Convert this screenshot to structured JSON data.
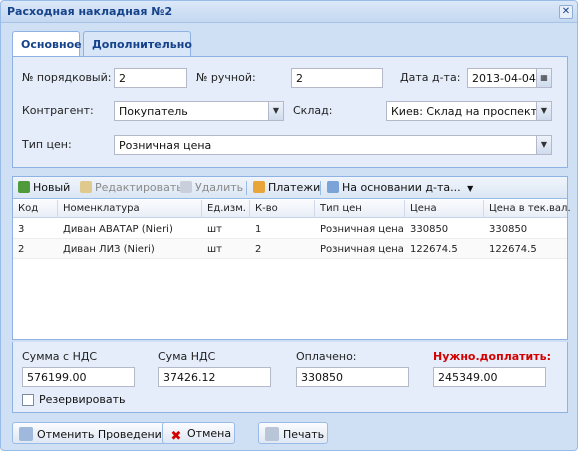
{
  "window": {
    "title": "Расходная накладная №2"
  },
  "tabs": [
    {
      "label": "Основное"
    },
    {
      "label": "Дополнительно"
    }
  ],
  "form": {
    "seq_label": "№ порядковый:",
    "seq_value": "2",
    "manual_label": "№ ручной:",
    "manual_value": "2",
    "date_label": "Дата д-та:",
    "date_value": "2013-04-04",
    "contractor_label": "Контрагент:",
    "contractor_value": "Покупатель",
    "warehouse_label": "Склад:",
    "warehouse_value": "Киев: Склад на проспекте N",
    "price_type_label": "Тип цен:",
    "price_type_value": "Розничная цена"
  },
  "toolbar": {
    "new": "Новый",
    "edit": "Редактировать",
    "delete": "Удалить",
    "payments": "Платежи",
    "based_on": "На основании д-та..."
  },
  "grid": {
    "columns": [
      "Код",
      "Номенклатура",
      "Ед.изм.",
      "К-во",
      "Тип цен",
      "Цена",
      "Цена в тек.вал."
    ],
    "rows": [
      [
        "3",
        "Диван АВАТАР (Nieri)",
        "шт",
        "1",
        "Розничная цена",
        "330850",
        "330850"
      ],
      [
        "2",
        "Диван ЛИЗ (Nieri)",
        "шт",
        "2",
        "Розничная цена",
        "122674.5",
        "122674.5"
      ]
    ]
  },
  "totals": {
    "sum_vat_label": "Сумма с НДС",
    "sum_vat_value": "576199.00",
    "vat_label": "Сума НДС",
    "vat_value": "37426.12",
    "paid_label": "Оплачено:",
    "paid_value": "330850",
    "due_label": "Нужно.доплатить:",
    "due_value": "245349.00",
    "reserve_label": "Резервировать"
  },
  "buttons": {
    "cancel_posting": "Отменить Проведение",
    "cancel": "Отмена",
    "print": "Печать"
  },
  "colors": {
    "accent": "#15428b",
    "due": "#d40000",
    "border": "#8db2e3"
  }
}
